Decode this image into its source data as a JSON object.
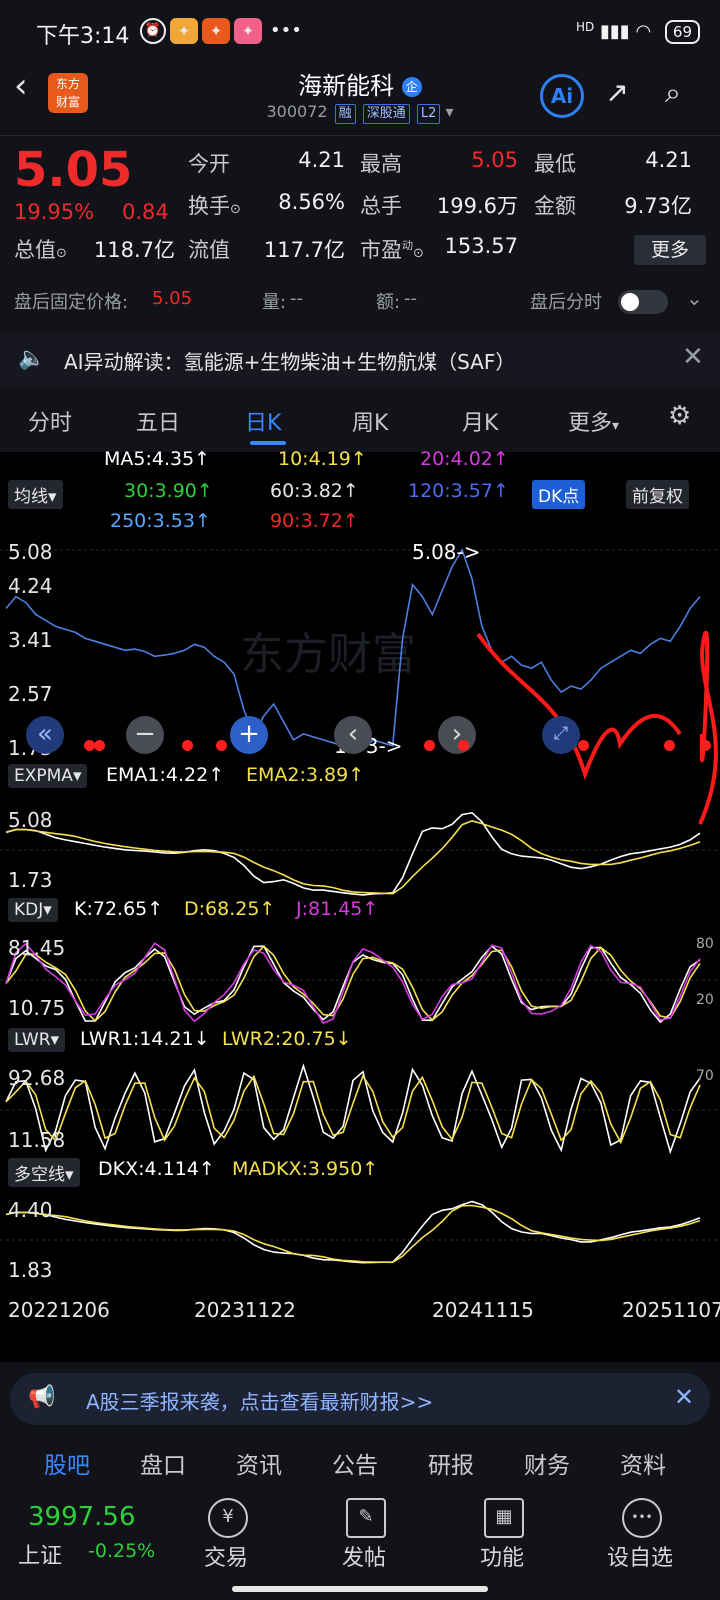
{
  "status_bar": {
    "time": "下午3:14",
    "icons": [
      "alarm-icon",
      "app-notif-1",
      "app-notif-2",
      "app-notif-3"
    ],
    "more": "•••",
    "network": "HD",
    "battery": "69"
  },
  "header": {
    "logo_line1": "东方",
    "logo_line2": "财富",
    "title": "海新能科",
    "title_badge": "企",
    "code": "300072",
    "tag1": "融",
    "tag2": "深股通",
    "tag3": "L2",
    "ai_label": "Ai"
  },
  "quote": {
    "price": "5.05",
    "change_pct": "19.95%",
    "change": "0.84",
    "open_label": "今开",
    "open": "4.21",
    "high_label": "最高",
    "high": "5.05",
    "low_label": "最低",
    "low": "4.21",
    "turnover_label": "换手",
    "turnover": "8.56%",
    "volume_label": "总手",
    "volume": "199.6万",
    "amount_label": "金额",
    "amount": "9.73亿",
    "mktcap_label": "总值",
    "mktcap": "118.7亿",
    "float_label": "流值",
    "float": "117.7亿",
    "pe_label": "市盈",
    "pe_sup": "动",
    "pe": "153.57",
    "more_button": "更多"
  },
  "after_hours": {
    "price_label": "盘后固定价格:",
    "price": "5.05",
    "vol_label": "量:",
    "vol": "--",
    "amt_label": "额:",
    "amt": "--",
    "timeshare_label": "盘后分时"
  },
  "ai_bar": {
    "text": "AI异动解读：氢能源+生物柴油+生物航煤（SAF）"
  },
  "tabs": [
    "分时",
    "五日",
    "日K",
    "周K",
    "月K",
    "更多"
  ],
  "active_tab": "日K",
  "indicators": {
    "ma_selector": "均线",
    "ma": [
      {
        "label": "MA5:4.35↑",
        "color": "#ffffff"
      },
      {
        "label": "10:4.19↑",
        "color": "#f4e04a"
      },
      {
        "label": "20:4.02↑",
        "color": "#d63be0"
      },
      {
        "label": "30:3.90↑",
        "color": "#2fcf3a"
      },
      {
        "label": "60:3.82↑",
        "color": "#e6e6e6"
      },
      {
        "label": "120:3.57↑",
        "color": "#4f6cf0"
      },
      {
        "label": "250:3.53↑",
        "color": "#55a9ff"
      },
      {
        "label": "90:3.72↑",
        "color": "#ee2b2b"
      }
    ],
    "dk_button": "DK点",
    "adjust_button": "前复权",
    "price_axis": [
      "5.08",
      "4.24",
      "3.41",
      "2.57",
      "1.73"
    ],
    "max_label": "5.08->",
    "min_label": "1.73->",
    "watermark": "东方财富",
    "expma": {
      "name": "EXPMA",
      "ema1": "EMA1:4.22↑",
      "ema2": "EMA2:3.89↑",
      "axis_top": "5.08",
      "axis_bottom": "1.73"
    },
    "kdj": {
      "name": "KDJ",
      "k": "K:72.65↑",
      "d": "D:68.25↑",
      "j": "J:81.45↑",
      "axis_top": "81.45",
      "axis_bottom": "10.75",
      "right_top": "80",
      "right_bottom": "20"
    },
    "lwr": {
      "name": "LWR",
      "lwr1": "LWR1:14.21↓",
      "lwr2": "LWR2:20.75↓",
      "axis_top": "92.68",
      "axis_bottom": "11.58",
      "right_top": "70"
    },
    "dkx": {
      "name": "多空线",
      "dkx": "DKX:4.114↑",
      "madkx": "MADKX:3.950↑",
      "axis_top": "4.40",
      "axis_bottom": "1.83"
    },
    "dates": [
      "20221206",
      "20231122",
      "20241115",
      "20251107"
    ]
  },
  "chart_data": {
    "type": "line",
    "title": "海新能科 日K",
    "x_start": "20221206",
    "x_end": "20251107",
    "y_range": [
      1.73,
      5.08
    ],
    "price_series": [
      4.1,
      4.3,
      4.2,
      4.0,
      3.9,
      3.8,
      3.75,
      3.7,
      3.6,
      3.55,
      3.5,
      3.45,
      3.4,
      3.42,
      3.38,
      3.3,
      3.32,
      3.35,
      3.4,
      3.5,
      3.45,
      3.3,
      3.2,
      3.0,
      2.4,
      2.0,
      2.3,
      2.5,
      2.2,
      1.9,
      2.0,
      1.95,
      1.9,
      1.85,
      1.8,
      1.78,
      1.73,
      1.9,
      1.85,
      1.8,
      3.6,
      4.5,
      4.3,
      4.0,
      4.4,
      4.8,
      5.08,
      4.6,
      3.8,
      3.4,
      3.2,
      3.3,
      3.15,
      3.1,
      3.2,
      2.9,
      2.7,
      2.8,
      2.75,
      2.9,
      3.1,
      3.2,
      3.3,
      3.4,
      3.35,
      3.5,
      3.6,
      3.55,
      3.8,
      4.1,
      4.3
    ],
    "markers": {
      "max": 5.08,
      "min": 1.73
    },
    "kdj": {
      "K": 72.65,
      "D": 68.25,
      "J": 81.45
    },
    "lwr": {
      "LWR1": 14.21,
      "LWR2": 20.75
    },
    "dkx": {
      "DKX": 4.114,
      "MADKX": 3.95
    },
    "expma": {
      "EMA1": 4.22,
      "EMA2": 3.89
    }
  },
  "banner": {
    "text": "A股三季报来袭，点击查看最新财报>>"
  },
  "bottom_tabs": [
    "股吧",
    "盘口",
    "资讯",
    "公告",
    "研报",
    "财务",
    "资料"
  ],
  "active_bottom_tab": "股吧",
  "dock": {
    "index_value": "3997.56",
    "index_name": "上证",
    "index_change": "-0.25%",
    "items": [
      {
        "label": "交易",
        "icon": "¥"
      },
      {
        "label": "发帖",
        "icon": "✎"
      },
      {
        "label": "功能",
        "icon": "▦"
      },
      {
        "label": "设自选",
        "icon": "•••"
      }
    ]
  }
}
